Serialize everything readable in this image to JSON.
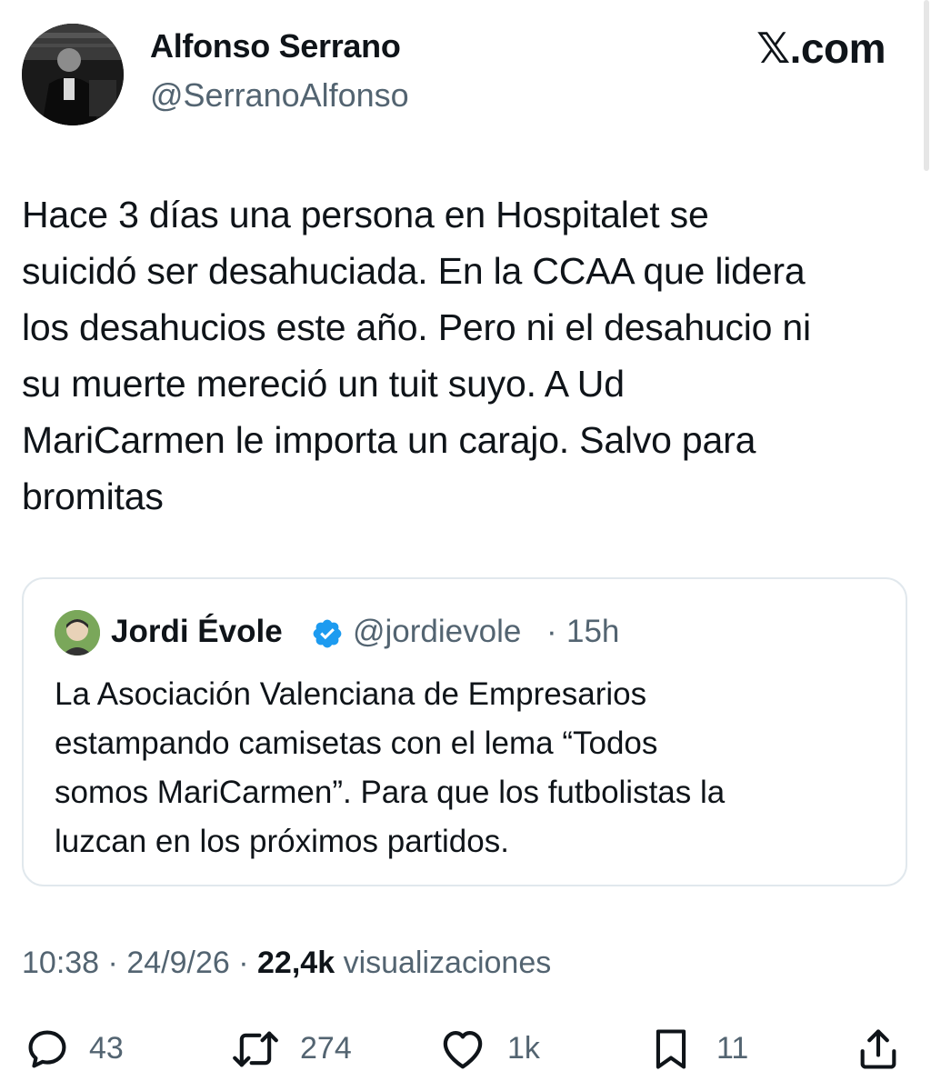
{
  "author": {
    "display_name": "Alfonso Serrano",
    "handle": "@SerranoAlfonso",
    "avatar_icon": "profile-photo"
  },
  "brand": "𝕏.com",
  "tweet": {
    "text": "Hace 3 días una persona en Hospitalet se\nsuicidó ser desahuciada. En la CCAA que lidera\nlos desahucios este año. Pero ni el desahucio ni\nsu muerte mereció un tuit suyo. A Ud\nMariCarmen le importa un carajo. Salvo para\nbromitas"
  },
  "quoted": {
    "display_name": "Jordi Évole",
    "verified": true,
    "handle": "@jordievole",
    "separator": "·",
    "time": "15h",
    "text": "La Asociación Valenciana de Empresarios\nestampando camisetas con el lema “Todos\nsomos MariCarmen”. Para que los futbolistas la\nluzcan en los próximos partidos.",
    "verified_color": "#1d9bf0"
  },
  "meta": {
    "time": "10:38",
    "sep1": "·",
    "date": "24/9/26",
    "sep2": "·",
    "views_count": "22,4k",
    "views_label": "visualizaciones"
  },
  "actions": {
    "replies": "43",
    "reposts": "274",
    "likes": "1k",
    "bookmarks": "11"
  },
  "colors": {
    "text_primary": "#0f1419",
    "text_secondary": "#536471",
    "border": "#e1e8ed"
  }
}
